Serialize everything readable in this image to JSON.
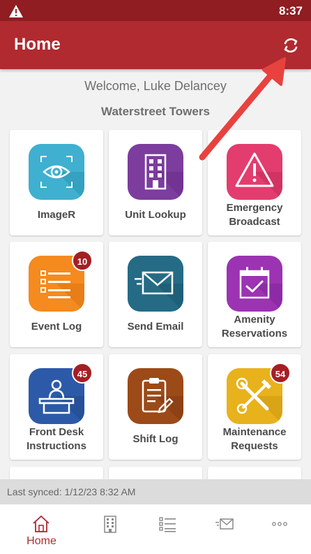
{
  "status_bar": {
    "time": "8:37",
    "warning_icon": "warning-icon"
  },
  "app_bar": {
    "title": "Home",
    "refresh_icon": "refresh-icon"
  },
  "welcome_text": "Welcome, Luke Delancey",
  "property_name": "Waterstreet Towers",
  "tiles": [
    {
      "label": "ImageR",
      "icon": "eye-scan-icon",
      "color": "#3fb0d0"
    },
    {
      "label": "Unit Lookup",
      "icon": "building-icon",
      "color": "#7c3d9e"
    },
    {
      "label": "Emergency Broadcast",
      "line1": "Emergency",
      "line2": "Broadcast",
      "icon": "alert-triangle-icon",
      "color": "#e23d6e"
    },
    {
      "label": "Event Log",
      "icon": "list-icon",
      "color": "#f58a1f",
      "badge": "10"
    },
    {
      "label": "Send Email",
      "icon": "envelope-icon",
      "color": "#256b85"
    },
    {
      "label": "Amenity Reservations",
      "line1": "Amenity",
      "line2": "Reservations",
      "icon": "calendar-check-icon",
      "color": "#9b33b3"
    },
    {
      "label": "Front Desk Instructions",
      "line1": "Front Desk",
      "line2": "Instructions",
      "icon": "front-desk-icon",
      "color": "#2c5aa8",
      "badge": "45"
    },
    {
      "label": "Shift Log",
      "icon": "clipboard-icon",
      "color": "#9c4a18"
    },
    {
      "label": "Maintenance Requests",
      "line1": "Maintenance",
      "line2": "Requests",
      "icon": "tools-icon",
      "color": "#e8b21c",
      "badge": "54"
    }
  ],
  "sync_text": "Last synced: 1/12/23 8:32 AM",
  "bottom_nav": [
    {
      "label": "Home",
      "icon": "home-icon",
      "active": true
    },
    {
      "label": "",
      "icon": "building-icon"
    },
    {
      "label": "",
      "icon": "list-icon"
    },
    {
      "label": "",
      "icon": "envelope-icon"
    },
    {
      "label": "",
      "icon": "more-icon"
    }
  ],
  "colors": {
    "app_bar": "#b02a30",
    "status_bar": "#8f1d22",
    "accent": "#b02a30",
    "badge": "#a41f25",
    "annotation_arrow": "#e8423f"
  }
}
